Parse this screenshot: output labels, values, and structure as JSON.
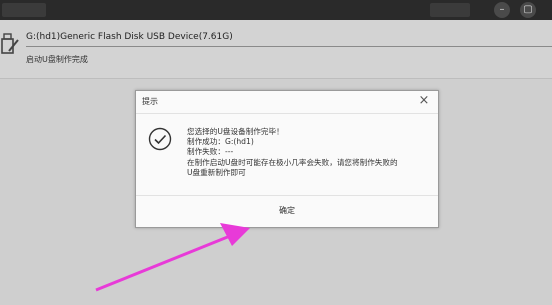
{
  "device": {
    "name": "G:(hd1)Generic Flash Disk USB Device(7.61G)",
    "status": "启动U盘制作完成"
  },
  "dialog": {
    "title": "提示",
    "close_glyph": "×",
    "lines": [
      "您选择的U盘设备制作完毕！",
      "制作成功：G:(hd1)",
      "制作失败：---",
      "在制作启动U盘时可能存在极小几率会失败，请您将制作失败的",
      "U盘重新制作即可"
    ],
    "ok_label": "确定"
  },
  "colors": {
    "arrow": "#e83ad8",
    "check": "#333333"
  },
  "icons": [
    "usb-drive-icon",
    "checkmark-circle-icon",
    "close-icon"
  ]
}
